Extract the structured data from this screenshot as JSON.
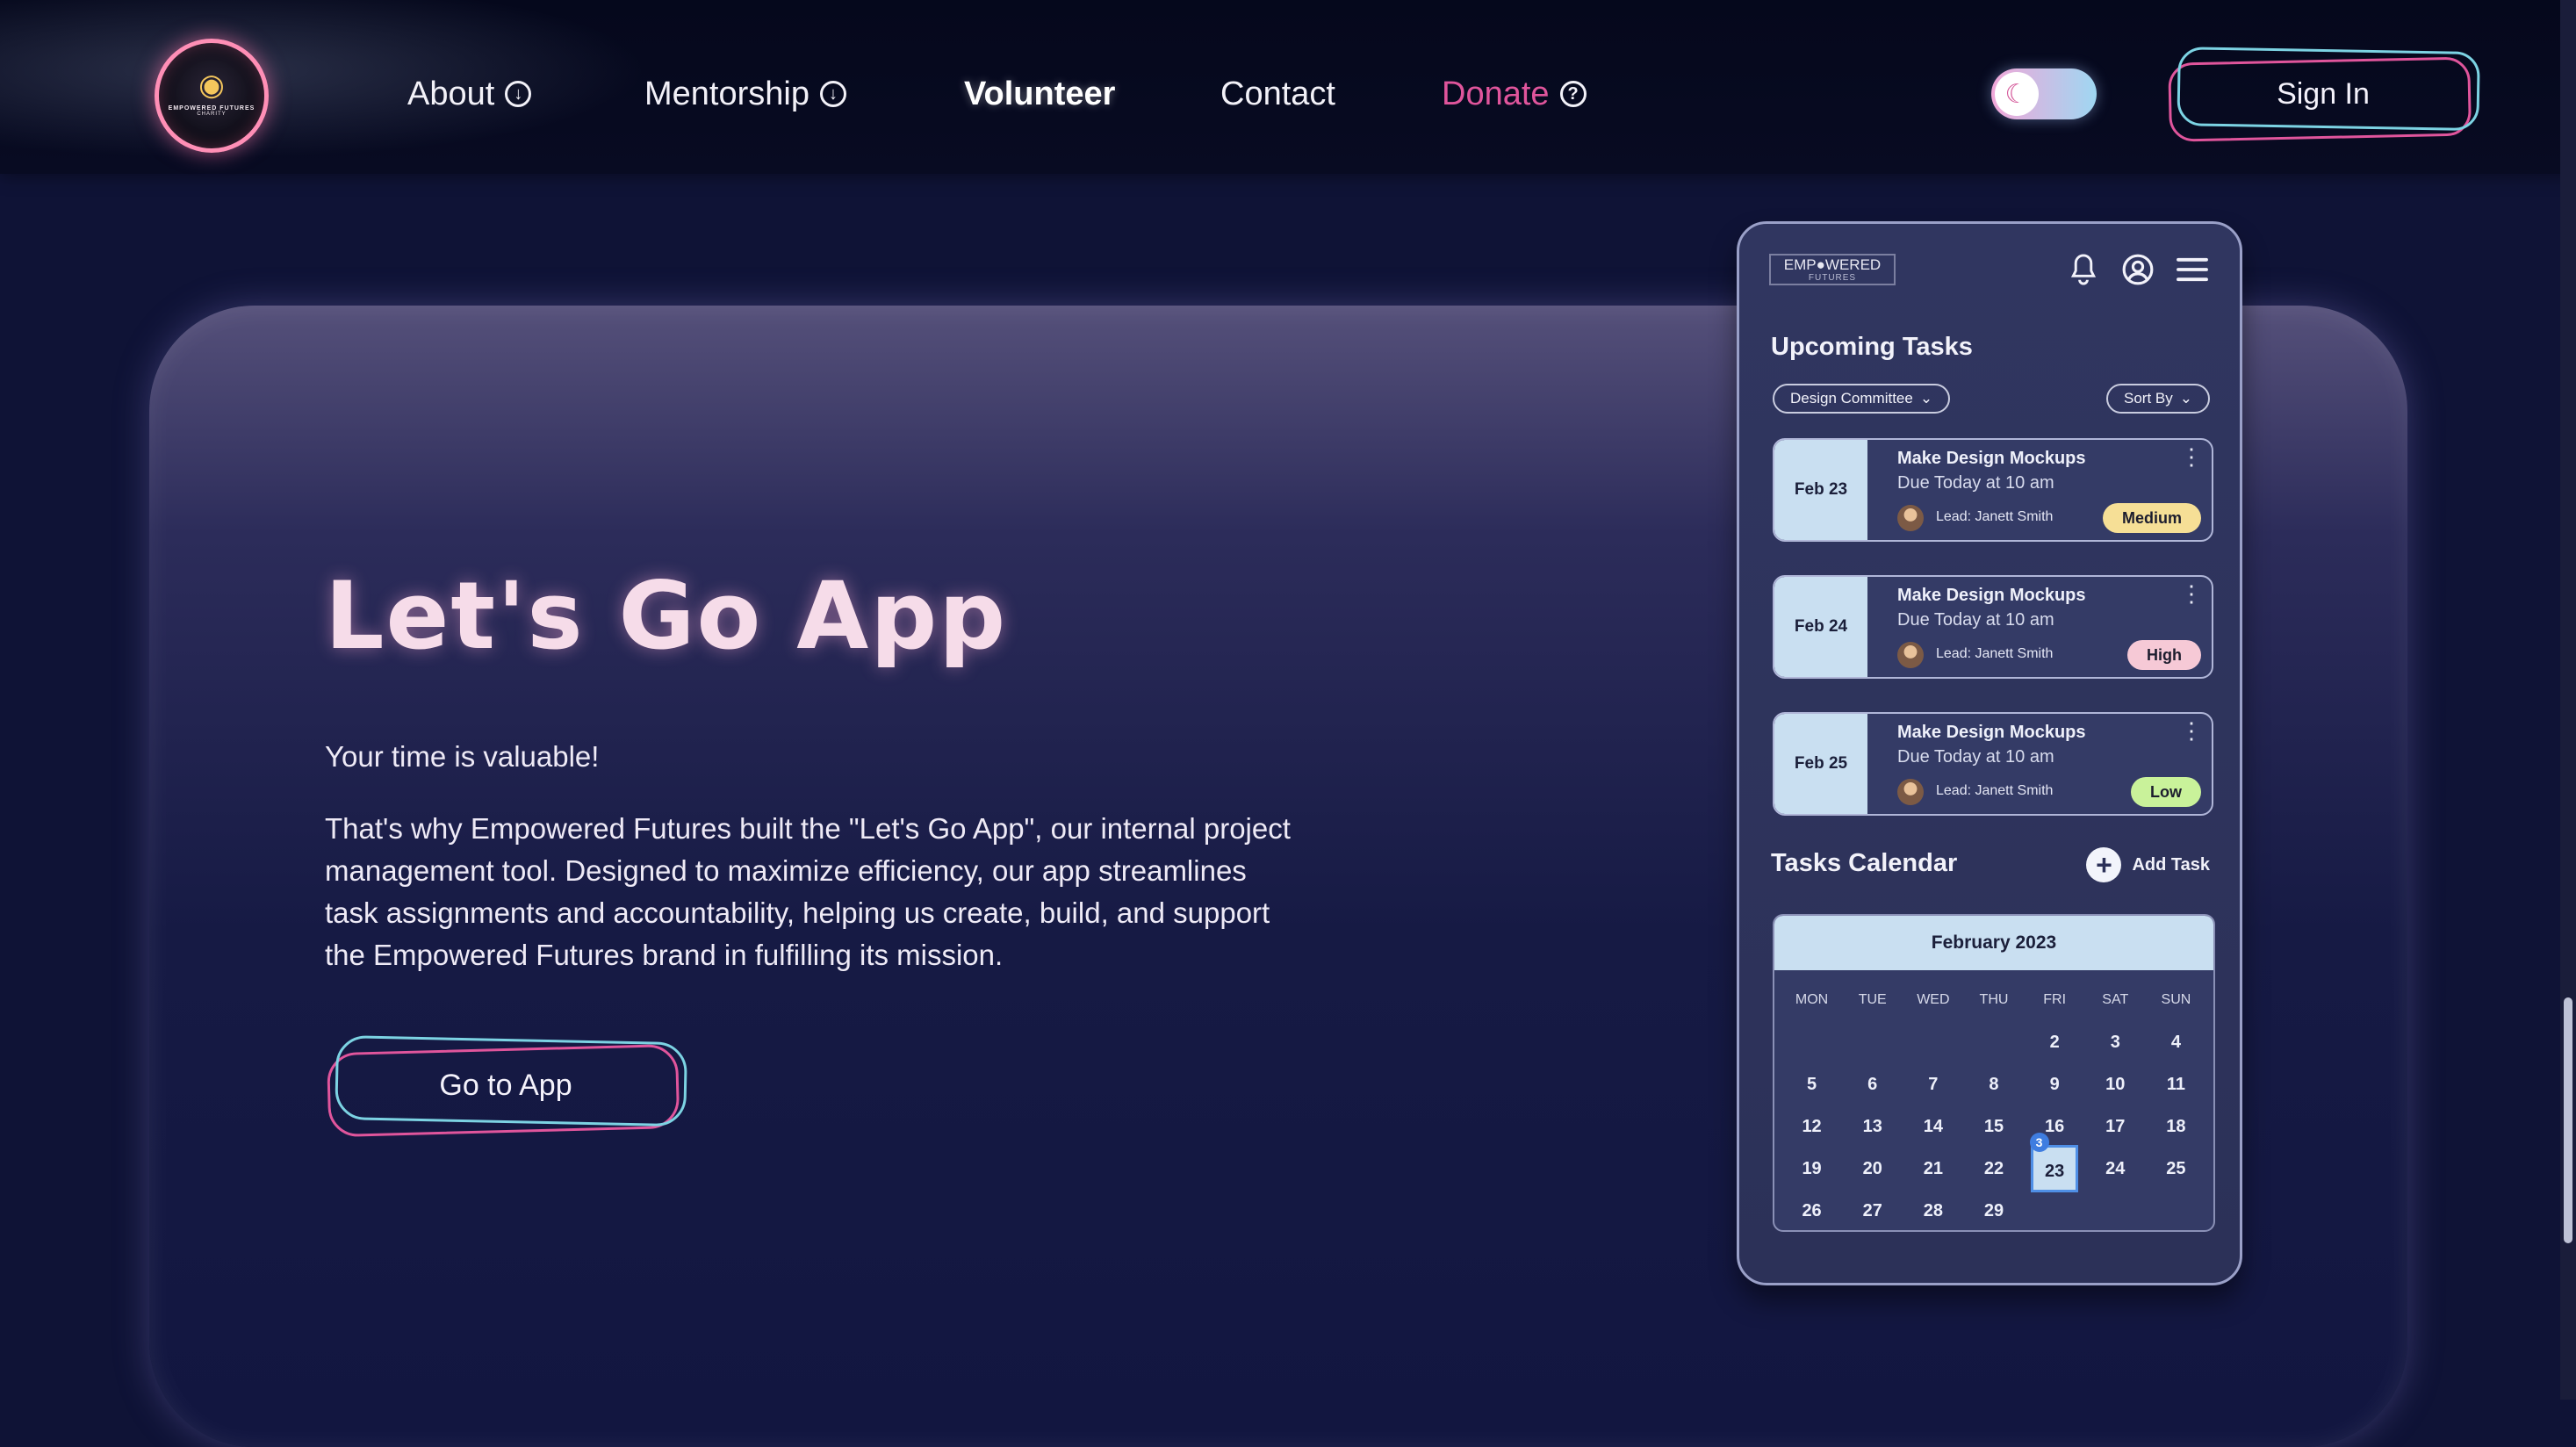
{
  "nav": {
    "logo_text": "EMPOWERED FUTURES",
    "logo_sub": "CHARITY",
    "items": [
      {
        "label": "About",
        "icon": "chevron-circle-down-icon"
      },
      {
        "label": "Mentorship",
        "icon": "chevron-circle-down-icon"
      },
      {
        "label": "Volunteer"
      },
      {
        "label": "Contact"
      },
      {
        "label": "Donate",
        "icon": "question-circle-icon"
      }
    ],
    "theme_toggle_icon": "moon-icon",
    "sign_in_label": "Sign In"
  },
  "hero": {
    "title": "Let's Go App",
    "tagline": "Your time is valuable!",
    "description": "That's why Empowered Futures built the \"Let's Go App\", our internal project management tool. Designed to maximize efficiency, our app streamlines task assignments and accountability, helping us create, build, and support the Empowered Futures brand in fulfilling its mission.",
    "cta_label": "Go to App"
  },
  "phone": {
    "logo_top": "EMP●WERED",
    "logo_bottom": "FUTURES",
    "upcoming_title": "Upcoming Tasks",
    "filter_label": "Design Committee",
    "sort_label": "Sort By",
    "tasks": [
      {
        "date": "Feb 23",
        "title": "Make Design Mockups",
        "due": "Due Today at 10 am",
        "lead": "Lead: Janett Smith",
        "priority": "Medium"
      },
      {
        "date": "Feb 24",
        "title": "Make Design Mockups",
        "due": "Due Today at 10 am",
        "lead": "Lead: Janett Smith",
        "priority": "High"
      },
      {
        "date": "Feb 25",
        "title": "Make Design Mockups",
        "due": "Due Today at 10 am",
        "lead": "Lead: Janett Smith",
        "priority": "Low"
      }
    ],
    "calendar_title": "Tasks Calendar",
    "add_task_label": "Add Task",
    "month_label": "February 2023",
    "weekdays": [
      "MON",
      "TUE",
      "WED",
      "THU",
      "FRI",
      "SAT",
      "SUN"
    ],
    "today": "23",
    "today_count": "3"
  },
  "colors": {
    "accent_pink": "#e0559c",
    "accent_cyan": "#7cd3e3",
    "background": "#0f1336",
    "priority_medium": "#f6df96",
    "priority_high": "#f6c9d6",
    "priority_low": "#c9f29a"
  }
}
